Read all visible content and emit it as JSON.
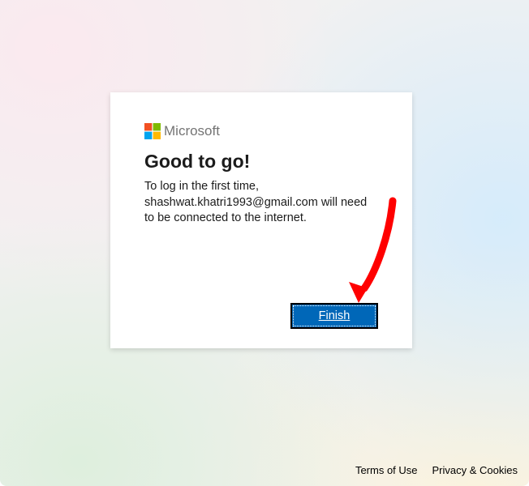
{
  "brand": {
    "name": "Microsoft"
  },
  "dialog": {
    "title": "Good to go!",
    "description": "To log in the first time, shashwat.khatri1993@gmail.com will need to be connected to the internet.",
    "finish_label": "Finish"
  },
  "footer": {
    "terms": "Terms of Use",
    "privacy": "Privacy & Cookies"
  }
}
